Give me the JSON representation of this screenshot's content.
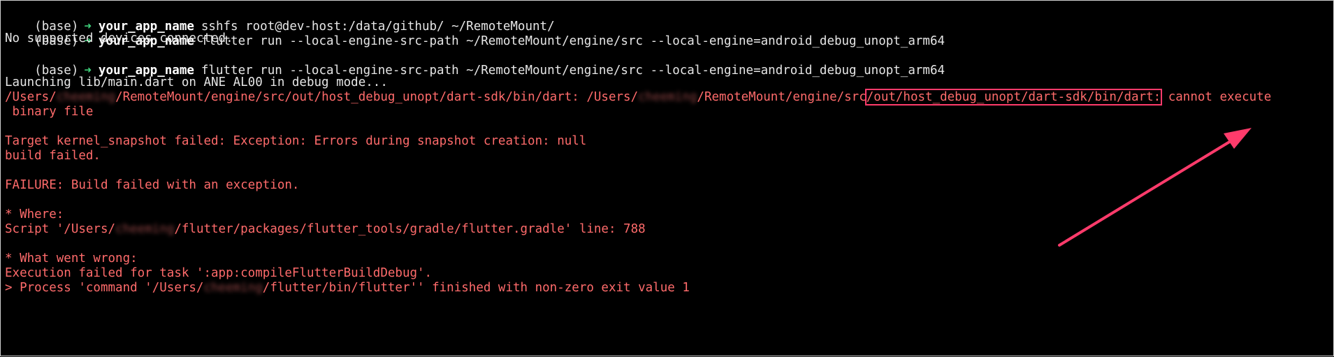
{
  "prompt": {
    "env": "(base)",
    "arrow": "➜",
    "app": "your_app_name"
  },
  "commands": [
    "sshfs root@dev-host:/data/github/ ~/RemoteMount/",
    "flutter run --local-engine-src-path ~/RemoteMount/engine/src --local-engine=android_debug_unopt_arm64",
    "flutter run --local-engine-src-path ~/RemoteMount/engine/src --local-engine=android_debug_unopt_arm64"
  ],
  "output": {
    "no_devices": "No supported devices connected.",
    "launching": "Launching lib/main.dart on ANE AL00 in debug mode...",
    "path_part1": "/Users/",
    "redacted": "cheeming",
    "path_part2": "/RemoteMount/engine/src/out/host_debug_unopt/dart-sdk/bin/dart: /Users/",
    "path_part3": "/RemoteMount/engine/src",
    "path_highlight": "/out/host_debug_unopt/dart-sdk/bin/dart:",
    "path_part4": " cannot execute",
    "binary_file": " binary file",
    "target_failed": "Target kernel_snapshot failed: Exception: Errors during snapshot creation: null",
    "build_failed": "build failed.",
    "failure": "FAILURE: Build failed with an exception.",
    "where": "* Where:",
    "script_prefix": "Script '/Users/",
    "script_suffix": "/flutter/packages/flutter_tools/gradle/flutter.gradle' line: 788",
    "what_went_wrong": "* What went wrong:",
    "execution_failed": "Execution failed for task ':app:compileFlutterBuildDebug'.",
    "process_prefix": "> Process 'command '/Users/",
    "process_suffix": "/flutter/bin/flutter'' finished with non-zero exit value 1"
  },
  "colors": {
    "background": "#000000",
    "error_text": "#ff6b6b",
    "prompt_arrow": "#3fd07a",
    "annotation": "#ff3b6b"
  }
}
